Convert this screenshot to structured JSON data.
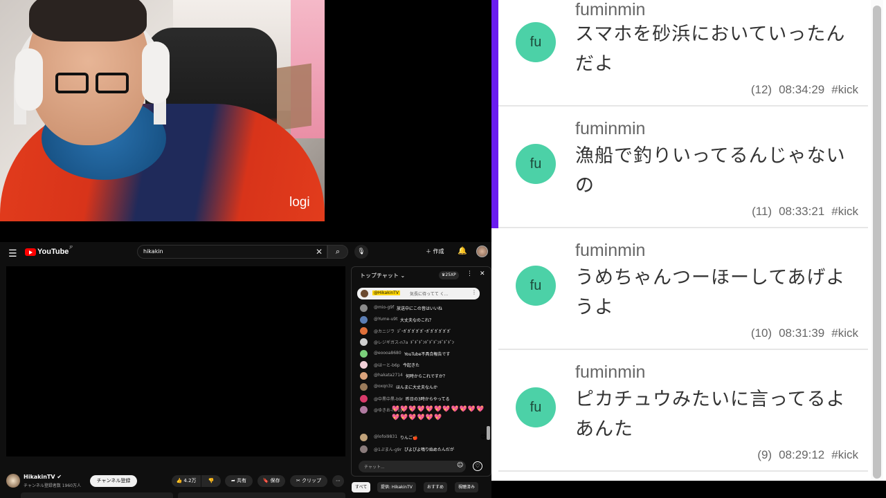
{
  "webcam": {
    "brand_logo": "logi"
  },
  "overlay": {
    "messages": [
      {
        "avatar": "fu",
        "user": "fuminmin",
        "text": "スマホを砂浜においていったんだよ",
        "count": "(12)",
        "time": "08:34:29",
        "tag": "#kick"
      },
      {
        "avatar": "fu",
        "user": "fuminmin",
        "text": "漁船で釣りいってるんじゃないの",
        "count": "(11)",
        "time": "08:33:21",
        "tag": "#kick"
      },
      {
        "avatar": "fu",
        "user": "fuminmin",
        "text": "うめちゃんつーほーしてあげようよ",
        "count": "(10)",
        "time": "08:31:39",
        "tag": "#kick"
      },
      {
        "avatar": "fu",
        "user": "fuminmin",
        "text": "ピカチュウみたいに言ってるよあんた",
        "count": "(9)",
        "time": "08:29:12",
        "tag": "#kick"
      }
    ],
    "accent_color": "#6a1df0",
    "avatar_color": "#4cd1a7"
  },
  "youtube": {
    "logo_text": "YouTube",
    "logo_sup": "JP",
    "search_value": "hikakin",
    "create_label": "作成",
    "channel": {
      "name": "HikakinTV",
      "subscribers": "チャンネル登録者数 1960万人"
    },
    "subscribe_label": "チャンネル登録",
    "actions": {
      "like": "4.2万",
      "share": "共有",
      "save": "保存",
      "clip": "クリップ"
    },
    "live_chat": {
      "title": "トップチャット",
      "xp": "25XP",
      "pinned": {
        "user": "@HikakinTV",
        "text": "気長に待ってて く..."
      },
      "rows": [
        {
          "user": "@mio-g9f",
          "msg": "放送中にこの音はいいね",
          "color": "#8a8a8a"
        },
        {
          "user": "@Yume-u9t",
          "msg": "大丈夫なのこれ？",
          "color": "#5b7db3"
        },
        {
          "user": "@カニジラ",
          "msg": "ｼﾞｰｶﾞｶﾞｶﾞｶﾞｶﾞｰｶﾞｶﾞｶﾞｶﾞｶﾞｶﾞ",
          "color": "#e0703a"
        },
        {
          "user": "@レジギガス-n7a",
          "msg": "ﾄﾞﾄﾞﾄﾞﾝﾄﾞﾄﾞﾄﾞﾝﾄﾞﾄﾞﾄﾞﾝ",
          "color": "#cfcfcf"
        },
        {
          "user": "@eoooa8680",
          "msg": "YouTube不具合報告です",
          "color": "#7bd07b"
        },
        {
          "user": "@はーと-b6p",
          "msg": "今起きた",
          "color": "#f2d0d8"
        },
        {
          "user": "@hakata2714",
          "msg": "何時からこれですか？",
          "color": "#d9a27b"
        },
        {
          "user": "@oxqn3z",
          "msg": "ほんまに大丈夫なんか",
          "color": "#9a7b5b"
        },
        {
          "user": "@中黒中黒-b9r",
          "msg": "昨日の3時からやってる",
          "color": "#d93a6a"
        },
        {
          "user": "@ゆきお-l7r1y",
          "msg": "",
          "color": "#b07aa0"
        },
        {
          "user": "@lofoi9831",
          "msg": "りんご🍎",
          "color": "#c0a27a"
        },
        {
          "user": "@1ぷまん-g9r",
          "msg": "ぴよぴよ鳴り始めたんだが",
          "color": "#8a7b7b"
        }
      ],
      "hearts_text": "💖💖💖💖💖💖💖💖💖💖💖💖💖💖💖💖💖",
      "input_placeholder": "チャット...",
      "chips": [
        "すべて",
        "提供: HikakinTV",
        "おすすめ",
        "視聴済み"
      ]
    }
  }
}
